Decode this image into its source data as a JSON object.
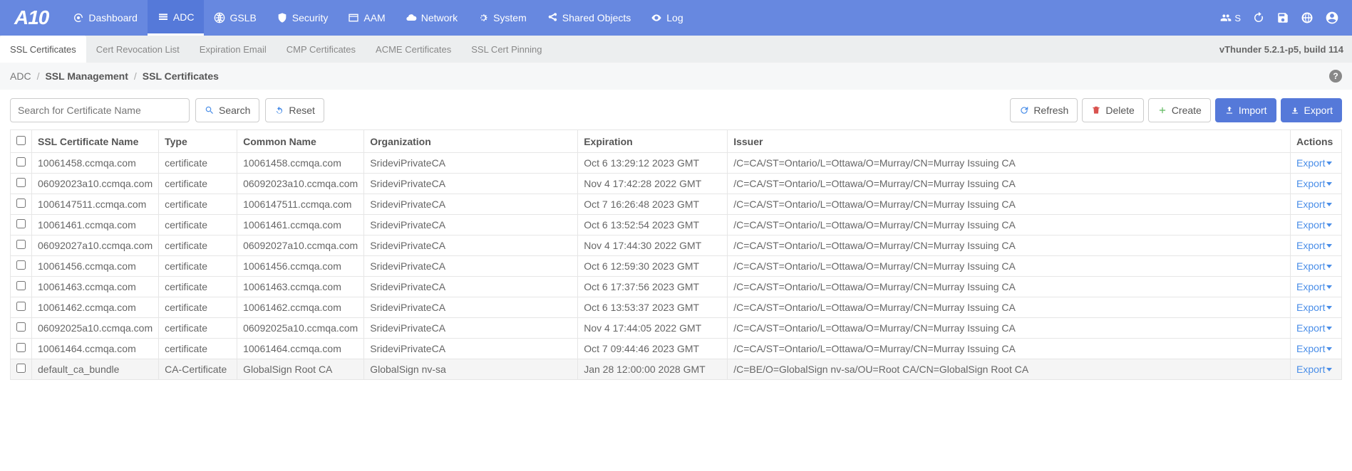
{
  "logo": "A10",
  "nav": [
    {
      "label": "Dashboard",
      "icon": "dashboard"
    },
    {
      "label": "ADC",
      "icon": "adc",
      "active": true
    },
    {
      "label": "GSLB",
      "icon": "globe"
    },
    {
      "label": "Security",
      "icon": "shield"
    },
    {
      "label": "AAM",
      "icon": "card"
    },
    {
      "label": "Network",
      "icon": "cloud"
    },
    {
      "label": "System",
      "icon": "gear"
    },
    {
      "label": "Shared Objects",
      "icon": "share"
    },
    {
      "label": "Log",
      "icon": "eye"
    }
  ],
  "navright": {
    "user_badge": "S"
  },
  "tabs": [
    {
      "label": "SSL Certificates",
      "active": true
    },
    {
      "label": "Cert Revocation List"
    },
    {
      "label": "Expiration Email"
    },
    {
      "label": "CMP Certificates"
    },
    {
      "label": "ACME Certificates"
    },
    {
      "label": "SSL Cert Pinning"
    }
  ],
  "version": "vThunder 5.2.1-p5, build 114",
  "breadcrumb": [
    "ADC",
    "SSL Management",
    "SSL Certificates"
  ],
  "toolbar": {
    "search_placeholder": "Search for Certificate Name",
    "search_btn": "Search",
    "reset_btn": "Reset",
    "refresh_btn": "Refresh",
    "delete_btn": "Delete",
    "create_btn": "Create",
    "import_btn": "Import",
    "export_btn": "Export"
  },
  "table": {
    "headers": [
      "SSL Certificate Name",
      "Type",
      "Common Name",
      "Organization",
      "Expiration",
      "Issuer",
      "Actions"
    ],
    "export_label": "Export",
    "rows": [
      {
        "name": "10061458.ccmqa.com",
        "type": "certificate",
        "cn": "10061458.ccmqa.com",
        "org": "SrideviPrivateCA",
        "exp": "Oct 6 13:29:12 2023 GMT",
        "issuer": "/C=CA/ST=Ontario/L=Ottawa/O=Murray/CN=Murray Issuing CA"
      },
      {
        "name": "06092023a10.ccmqa.com",
        "type": "certificate",
        "cn": "06092023a10.ccmqa.com",
        "org": "SrideviPrivateCA",
        "exp": "Nov 4 17:42:28 2022 GMT",
        "issuer": "/C=CA/ST=Ontario/L=Ottawa/O=Murray/CN=Murray Issuing CA"
      },
      {
        "name": "1006147511.ccmqa.com",
        "type": "certificate",
        "cn": "1006147511.ccmqa.com",
        "org": "SrideviPrivateCA",
        "exp": "Oct 7 16:26:48 2023 GMT",
        "issuer": "/C=CA/ST=Ontario/L=Ottawa/O=Murray/CN=Murray Issuing CA"
      },
      {
        "name": "10061461.ccmqa.com",
        "type": "certificate",
        "cn": "10061461.ccmqa.com",
        "org": "SrideviPrivateCA",
        "exp": "Oct 6 13:52:54 2023 GMT",
        "issuer": "/C=CA/ST=Ontario/L=Ottawa/O=Murray/CN=Murray Issuing CA"
      },
      {
        "name": "06092027a10.ccmqa.com",
        "type": "certificate",
        "cn": "06092027a10.ccmqa.com",
        "org": "SrideviPrivateCA",
        "exp": "Nov 4 17:44:30 2022 GMT",
        "issuer": "/C=CA/ST=Ontario/L=Ottawa/O=Murray/CN=Murray Issuing CA"
      },
      {
        "name": "10061456.ccmqa.com",
        "type": "certificate",
        "cn": "10061456.ccmqa.com",
        "org": "SrideviPrivateCA",
        "exp": "Oct 6 12:59:30 2023 GMT",
        "issuer": "/C=CA/ST=Ontario/L=Ottawa/O=Murray/CN=Murray Issuing CA"
      },
      {
        "name": "10061463.ccmqa.com",
        "type": "certificate",
        "cn": "10061463.ccmqa.com",
        "org": "SrideviPrivateCA",
        "exp": "Oct 6 17:37:56 2023 GMT",
        "issuer": "/C=CA/ST=Ontario/L=Ottawa/O=Murray/CN=Murray Issuing CA"
      },
      {
        "name": "10061462.ccmqa.com",
        "type": "certificate",
        "cn": "10061462.ccmqa.com",
        "org": "SrideviPrivateCA",
        "exp": "Oct 6 13:53:37 2023 GMT",
        "issuer": "/C=CA/ST=Ontario/L=Ottawa/O=Murray/CN=Murray Issuing CA"
      },
      {
        "name": "06092025a10.ccmqa.com",
        "type": "certificate",
        "cn": "06092025a10.ccmqa.com",
        "org": "SrideviPrivateCA",
        "exp": "Nov 4 17:44:05 2022 GMT",
        "issuer": "/C=CA/ST=Ontario/L=Ottawa/O=Murray/CN=Murray Issuing CA"
      },
      {
        "name": "10061464.ccmqa.com",
        "type": "certificate",
        "cn": "10061464.ccmqa.com",
        "org": "SrideviPrivateCA",
        "exp": "Oct 7 09:44:46 2023 GMT",
        "issuer": "/C=CA/ST=Ontario/L=Ottawa/O=Murray/CN=Murray Issuing CA"
      },
      {
        "name": "default_ca_bundle",
        "type": "CA-Certificate",
        "cn": "GlobalSign Root CA",
        "org": "GlobalSign nv-sa",
        "exp": "Jan 28 12:00:00 2028 GMT",
        "issuer": "/C=BE/O=GlobalSign nv-sa/OU=Root CA/CN=GlobalSign Root CA"
      }
    ]
  }
}
